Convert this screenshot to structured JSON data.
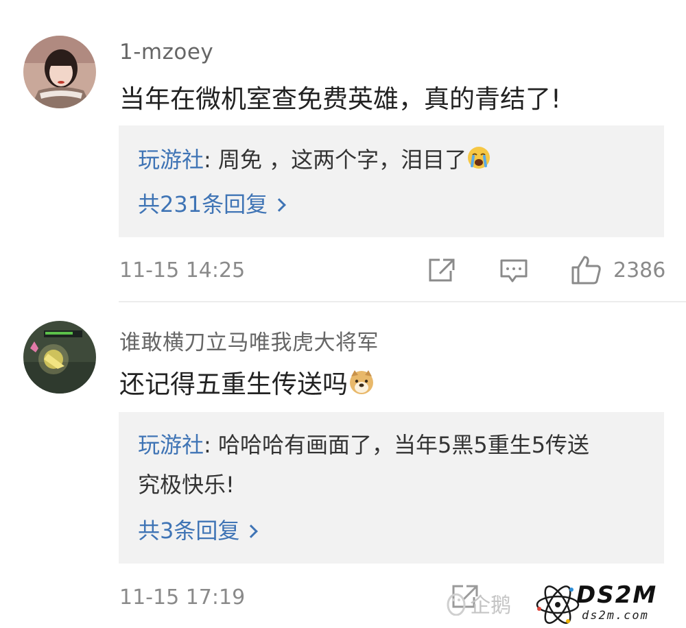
{
  "comments": [
    {
      "username": "1-mzoey",
      "text": "当年在微机室查免费英雄，真的青结了!",
      "reply": {
        "author": "玩游社",
        "separator": ": ",
        "text": "周免 ，这两个字，泪目了",
        "emoji": "crying-face-emoji",
        "count_label": "共231条回复"
      },
      "timestamp": "11-15 14:25",
      "likes": "2386"
    },
    {
      "username": "谁敢横刀立马唯我虎大将军",
      "text": "还记得五重生传送吗",
      "emoji": "doge-emoji",
      "reply": {
        "author": "玩游社",
        "separator": ": ",
        "text_line1": "哈哈哈有画面了，当年5黑5重生5传送",
        "text_line2": "究极快乐!",
        "count_label": "共3条回复"
      },
      "timestamp": "11-15 17:19"
    }
  ],
  "watermark": {
    "penguin_label": "企鹅",
    "site_logo": "DS2M",
    "site_url": "ds2m.com"
  },
  "colors": {
    "link": "#3f74b5",
    "meta": "#8a8a8a",
    "reply_bg": "#f2f2f2"
  }
}
